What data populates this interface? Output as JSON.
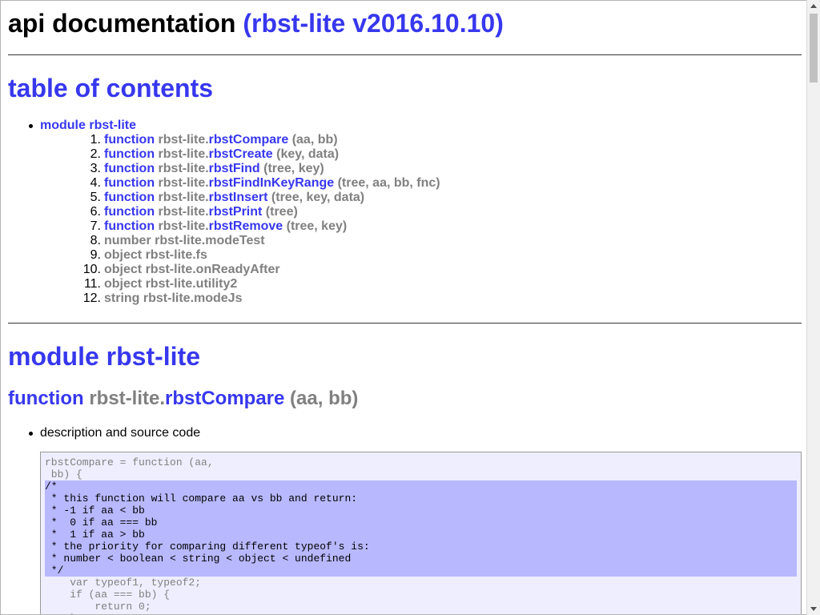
{
  "header": {
    "title": "api documentation",
    "version": "(rbst-lite v2016.10.10)"
  },
  "toc": {
    "title": "table of contents",
    "module": "module rbst-lite",
    "items": [
      {
        "num": "1.",
        "kw": "function",
        "prefix": "rbst-lite.",
        "fn": "rbstCompare",
        "args": "(aa, bb)"
      },
      {
        "num": "2.",
        "kw": "function",
        "prefix": "rbst-lite.",
        "fn": "rbstCreate",
        "args": "(key, data)"
      },
      {
        "num": "3.",
        "kw": "function",
        "prefix": "rbst-lite.",
        "fn": "rbstFind",
        "args": "(tree, key)"
      },
      {
        "num": "4.",
        "kw": "function",
        "prefix": "rbst-lite.",
        "fn": "rbstFindInKeyRange",
        "args": "(tree, aa, bb, fnc)"
      },
      {
        "num": "5.",
        "kw": "function",
        "prefix": "rbst-lite.",
        "fn": "rbstInsert",
        "args": "(tree, key, data)"
      },
      {
        "num": "6.",
        "kw": "function",
        "prefix": "rbst-lite.",
        "fn": "rbstPrint",
        "args": "(tree)"
      },
      {
        "num": "7.",
        "kw": "function",
        "prefix": "rbst-lite.",
        "fn": "rbstRemove",
        "args": "(tree, key)"
      },
      {
        "num": "8.",
        "kw": "",
        "prefix": "number rbst-lite.modeTest",
        "fn": "",
        "args": ""
      },
      {
        "num": "9.",
        "kw": "",
        "prefix": "object rbst-lite.fs",
        "fn": "",
        "args": ""
      },
      {
        "num": "10.",
        "kw": "",
        "prefix": "object rbst-lite.onReadyAfter",
        "fn": "",
        "args": ""
      },
      {
        "num": "11.",
        "kw": "",
        "prefix": "object rbst-lite.utility2",
        "fn": "",
        "args": ""
      },
      {
        "num": "12.",
        "kw": "",
        "prefix": "string rbst-lite.modeJs",
        "fn": "",
        "args": ""
      }
    ]
  },
  "module_section": {
    "title": "module rbst-lite",
    "function": {
      "kw": "function",
      "prefix": "rbst-lite.",
      "fn": "rbstCompare",
      "args": "(aa, bb)"
    },
    "description_label": "description and source code",
    "code_lines": [
      {
        "text": "rbstCompare = function (aa,",
        "hl": false
      },
      {
        "text": " bb) {",
        "hl": false
      },
      {
        "text": "/*",
        "hl": true
      },
      {
        "text": " * this function will compare aa vs bb and return:",
        "hl": true
      },
      {
        "text": " * -1 if aa < bb",
        "hl": true
      },
      {
        "text": " *  0 if aa === bb",
        "hl": true
      },
      {
        "text": " *  1 if aa > bb",
        "hl": true
      },
      {
        "text": " * the priority for comparing different typeof's is:",
        "hl": true
      },
      {
        "text": " * number < boolean < string < object < undefined",
        "hl": true
      },
      {
        "text": " */",
        "hl": true
      },
      {
        "text": "    var typeof1, typeof2;",
        "hl": false
      },
      {
        "text": "    if (aa === bb) {",
        "hl": false
      },
      {
        "text": "        return 0;",
        "hl": false
      },
      {
        "text": "    }",
        "hl": false
      }
    ]
  }
}
